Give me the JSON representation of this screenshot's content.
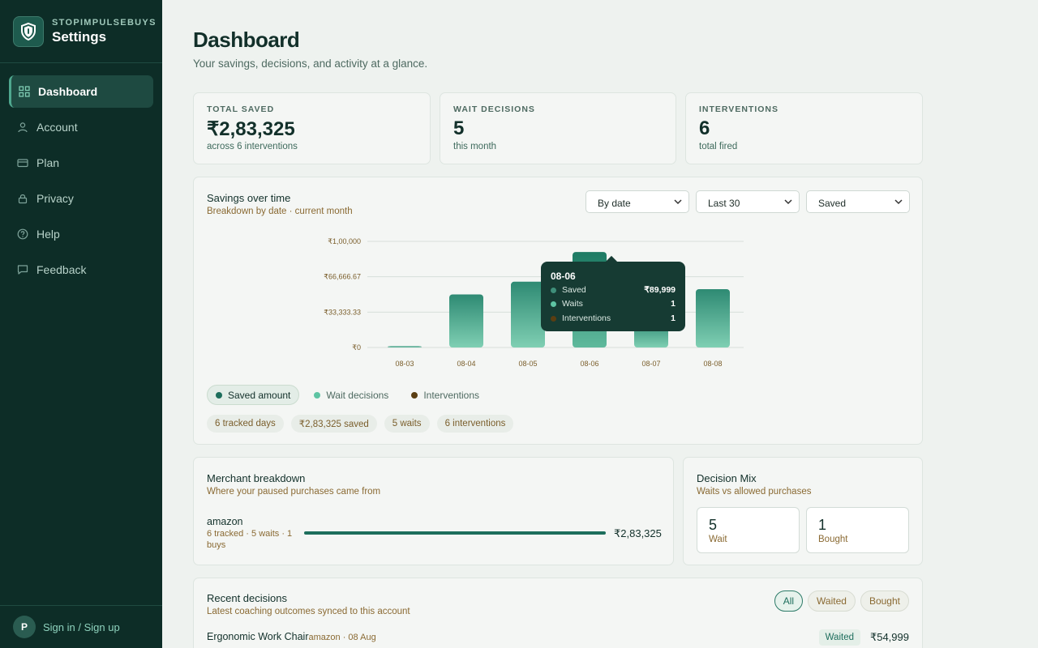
{
  "brand": {
    "name": "STOPIMPULSEBUYS",
    "section": "Settings"
  },
  "nav": [
    {
      "label": "Dashboard",
      "icon": "grid-icon",
      "active": true
    },
    {
      "label": "Account",
      "icon": "user-icon"
    },
    {
      "label": "Plan",
      "icon": "credit-card-icon"
    },
    {
      "label": "Privacy",
      "icon": "lock-icon"
    },
    {
      "label": "Help",
      "icon": "help-circle-icon"
    },
    {
      "label": "Feedback",
      "icon": "message-icon"
    }
  ],
  "user": {
    "initial": "P",
    "signin_label": "Sign in / Sign up"
  },
  "page": {
    "title": "Dashboard",
    "subtitle": "Your savings, decisions, and activity at a glance."
  },
  "kpis": [
    {
      "label": "TOTAL SAVED",
      "value": "₹2,83,325",
      "sub": "across 6 interventions"
    },
    {
      "label": "WAIT DECISIONS",
      "value": "5",
      "sub": "this month"
    },
    {
      "label": "INTERVENTIONS",
      "value": "6",
      "sub": "total fired"
    }
  ],
  "savings": {
    "title": "Savings over time",
    "subtitle": "Breakdown by date · current month",
    "selects": {
      "group": "By date",
      "range": "Last 30",
      "metric": "Saved"
    },
    "legend": [
      {
        "label": "Saved amount",
        "color": "#1d6e5c",
        "active": true
      },
      {
        "label": "Wait decisions",
        "color": "#5ec4a3"
      },
      {
        "label": "Interventions",
        "color": "#5a3e12"
      }
    ],
    "stats": [
      "6 tracked days",
      "₹2,83,325 saved",
      "5 waits",
      "6 interventions"
    ],
    "tooltip": {
      "date": "08-06",
      "rows": [
        {
          "label": "Saved",
          "value": "₹89,999",
          "color": "#3f8f7a"
        },
        {
          "label": "Waits",
          "value": "1",
          "color": "#5ec4a3"
        },
        {
          "label": "Interventions",
          "value": "1",
          "color": "#5a3e12"
        }
      ]
    }
  },
  "chart_data": {
    "type": "bar",
    "categories": [
      "08-03",
      "08-04",
      "08-05",
      "08-06",
      "08-07",
      "08-08"
    ],
    "series": [
      {
        "name": "Saved amount",
        "values": [
          1200,
          50000,
          62000,
          89999,
          25000,
          54999
        ]
      }
    ],
    "ylim": [
      0,
      100000
    ],
    "yticks": [
      "₹0",
      "₹33,333.33",
      "₹66,666.67",
      "₹1,00,000"
    ],
    "ytick_values": [
      0,
      33333.33,
      66666.67,
      100000
    ],
    "grid": true
  },
  "merchants": {
    "title": "Merchant breakdown",
    "subtitle": "Where your paused purchases came from",
    "items": [
      {
        "name": "amazon",
        "desc": "6 tracked · 5 waits · 1 buys",
        "value": "₹2,83,325",
        "share": 1
      }
    ]
  },
  "decision_mix": {
    "title": "Decision Mix",
    "subtitle": "Waits vs allowed purchases",
    "items": [
      {
        "count": "5",
        "label": "Wait"
      },
      {
        "count": "1",
        "label": "Bought"
      }
    ]
  },
  "recent": {
    "title": "Recent decisions",
    "subtitle": "Latest coaching outcomes synced to this account",
    "filters": [
      "All",
      "Waited",
      "Bought"
    ],
    "rows": [
      {
        "title": "Ergonomic Work Chair",
        "meta": "amazon · 08 Aug",
        "status": "Waited",
        "price": "₹54,999"
      }
    ]
  }
}
